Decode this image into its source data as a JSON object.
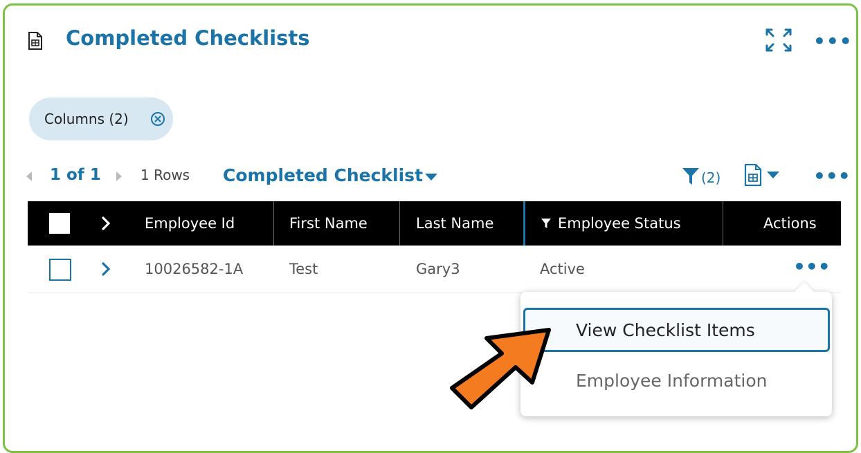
{
  "widget": {
    "title": "Completed Checklists"
  },
  "filters": {
    "columns_chip": "Columns (2)"
  },
  "toolbar": {
    "pager": "1 of 1",
    "rows": "1 Rows",
    "view_name": "Completed Checklist",
    "filter_count": "(2)"
  },
  "table": {
    "columns": [
      "Employee Id",
      "First Name",
      "Last Name",
      "Employee Status",
      "Actions"
    ],
    "rows": [
      {
        "employee_id": "10026582-1A",
        "first_name": "Test",
        "last_name": "Gary3",
        "employee_status": "Active"
      }
    ]
  },
  "row_menu": {
    "items": [
      "View Checklist Items",
      "Employee Information"
    ]
  },
  "colors": {
    "accent": "#1a74a8",
    "frame": "#7bc144",
    "arrow": "#f47b20"
  }
}
